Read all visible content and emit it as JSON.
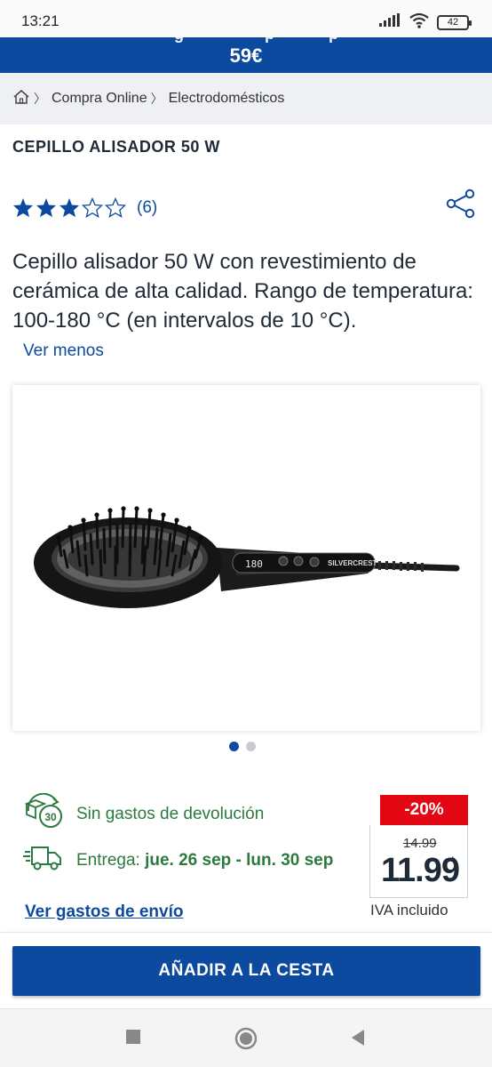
{
  "status_bar": {
    "time": "13:21",
    "battery": "42"
  },
  "promo": {
    "price_text": "59€"
  },
  "breadcrumb": {
    "items": [
      "Compra Online",
      "Electrodomésticos"
    ]
  },
  "product": {
    "title": "CEPILLO ALISADOR 50 W",
    "rating": {
      "value": 3,
      "max": 5,
      "count_text": "(6)"
    },
    "description": "Cepillo alisador 50 W con revestimiento de cerámica de alta calidad. Rango de temperatura: 100-180 °C (en intervalos de 10 °C).",
    "toggle_label": "Ver menos",
    "image_brand": "SILVERCREST",
    "image_display": "180",
    "gallery": {
      "count": 2,
      "active": 0
    }
  },
  "benefits": {
    "returns": "Sin gastos de devolución",
    "returns_days": "30",
    "delivery_label": "Entrega:",
    "delivery_dates": "jue. 26 sep - lun. 30 sep",
    "shipping_link": "Ver gastos de envío"
  },
  "price": {
    "discount": "-20%",
    "old": "14.99",
    "current": "11.99",
    "asterisk": "*",
    "vat": "IVA incluido"
  },
  "cta": {
    "add_to_cart": "AÑADIR A LA CESTA"
  },
  "colors": {
    "brand_blue": "#0c4a9f",
    "discount_red": "#e30613",
    "benefit_green": "#2b7a3e"
  },
  "icons": [
    "signal-icon",
    "wifi-icon",
    "battery-icon",
    "home-icon",
    "chevron-right-icon",
    "star-icon",
    "share-icon",
    "return-box-icon",
    "truck-icon",
    "nav-square-icon",
    "nav-circle-icon",
    "nav-back-icon"
  ]
}
